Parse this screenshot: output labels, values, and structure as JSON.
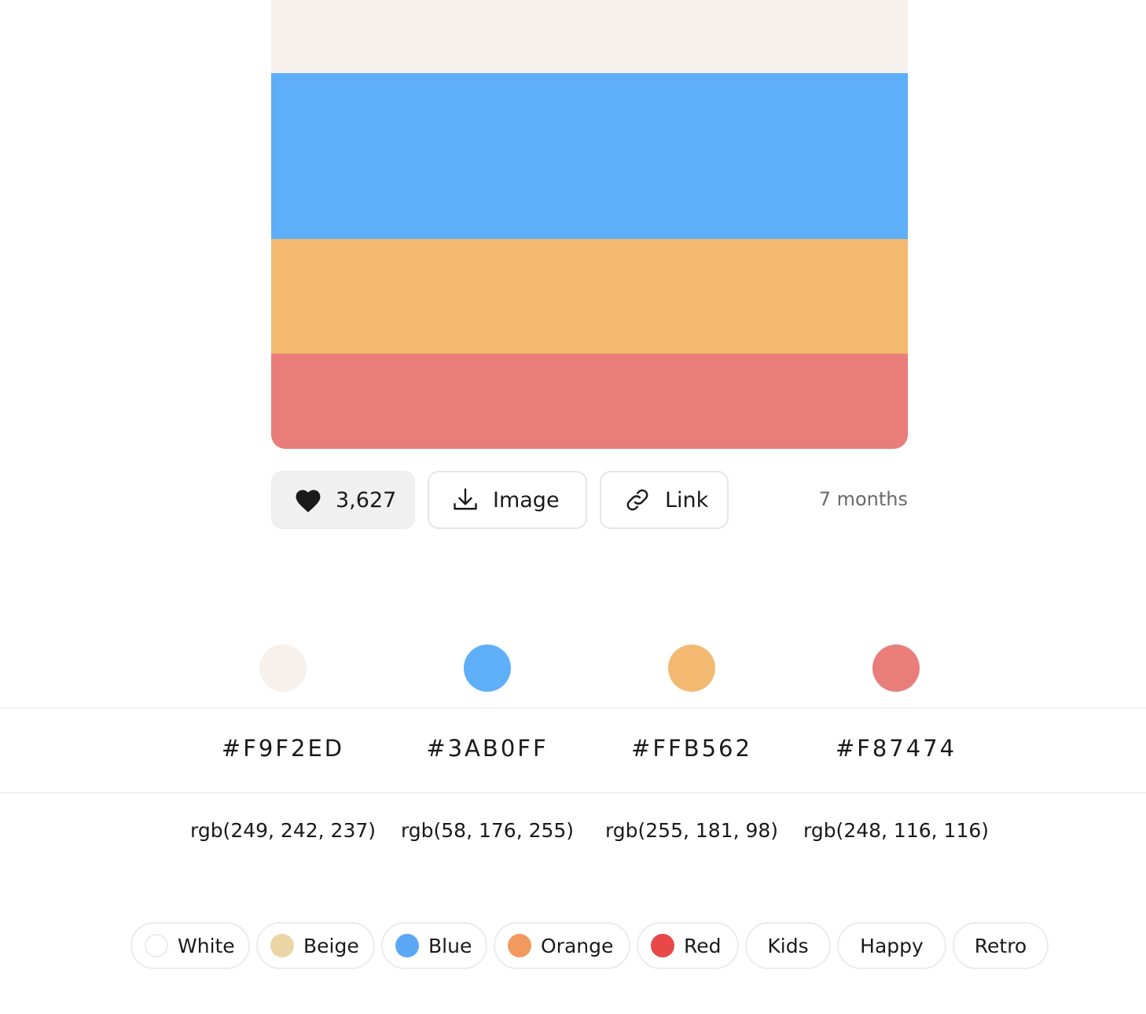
{
  "palette": {
    "colors": [
      "#F9F2ED",
      "#3AB0FF",
      "#FFB562",
      "#F87474"
    ],
    "band_shades": [
      "#F6F1ED",
      "#5EAFF8",
      "#F3B971",
      "#E97D79"
    ]
  },
  "actions": {
    "likes": "3,627",
    "image_label": "Image",
    "link_label": "Link",
    "age": "7 months"
  },
  "swatches": [
    {
      "hex": "#F9F2ED",
      "rgb": "rgb(249, 242, 237)",
      "dot": "#F6F1ED"
    },
    {
      "hex": "#3AB0FF",
      "rgb": "rgb(58, 176, 255)",
      "dot": "#5EAFF8"
    },
    {
      "hex": "#FFB562",
      "rgb": "rgb(255, 181, 98)",
      "dot": "#F3B971"
    },
    {
      "hex": "#F87474",
      "rgb": "rgb(248, 116, 116)",
      "dot": "#E97D79"
    }
  ],
  "tags": [
    {
      "label": "White",
      "dot": "#FFFFFF"
    },
    {
      "label": "Beige",
      "dot": "#EBD5A5"
    },
    {
      "label": "Blue",
      "dot": "#5BA7F5"
    },
    {
      "label": "Orange",
      "dot": "#F2995F"
    },
    {
      "label": "Red",
      "dot": "#E84848"
    },
    {
      "label": "Kids"
    },
    {
      "label": "Happy"
    },
    {
      "label": "Retro"
    }
  ],
  "icons": {
    "like": "heart-icon",
    "image": "download-icon",
    "link": "link-icon"
  }
}
